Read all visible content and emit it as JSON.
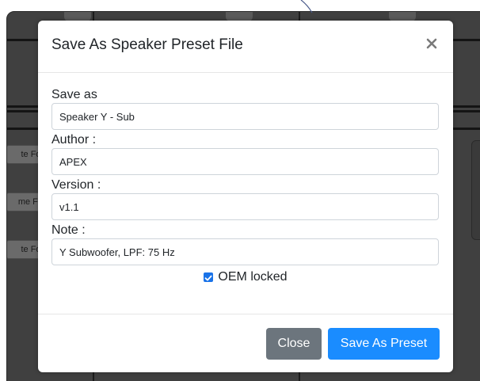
{
  "background": {
    "side_buttons": [
      "te Fol",
      "me Fo",
      "te Fol"
    ]
  },
  "dialog": {
    "title": "Save As Speaker Preset File",
    "close_icon": "close-icon",
    "fields": [
      {
        "label": "Save as",
        "value": "Speaker Y - Sub"
      },
      {
        "label": "Author :",
        "value": "APEX"
      },
      {
        "label": "Version :",
        "value": "v1.1"
      },
      {
        "label": "Note :",
        "value": "Y Subwoofer, LPF: 75 Hz"
      }
    ],
    "oem_locked": {
      "label": "OEM locked",
      "checked": true
    },
    "buttons": {
      "close": "Close",
      "save": "Save As Preset"
    }
  },
  "colors": {
    "primary": "#1a8cff",
    "secondary": "#6c757d",
    "checkbox": "#1a73e8"
  }
}
